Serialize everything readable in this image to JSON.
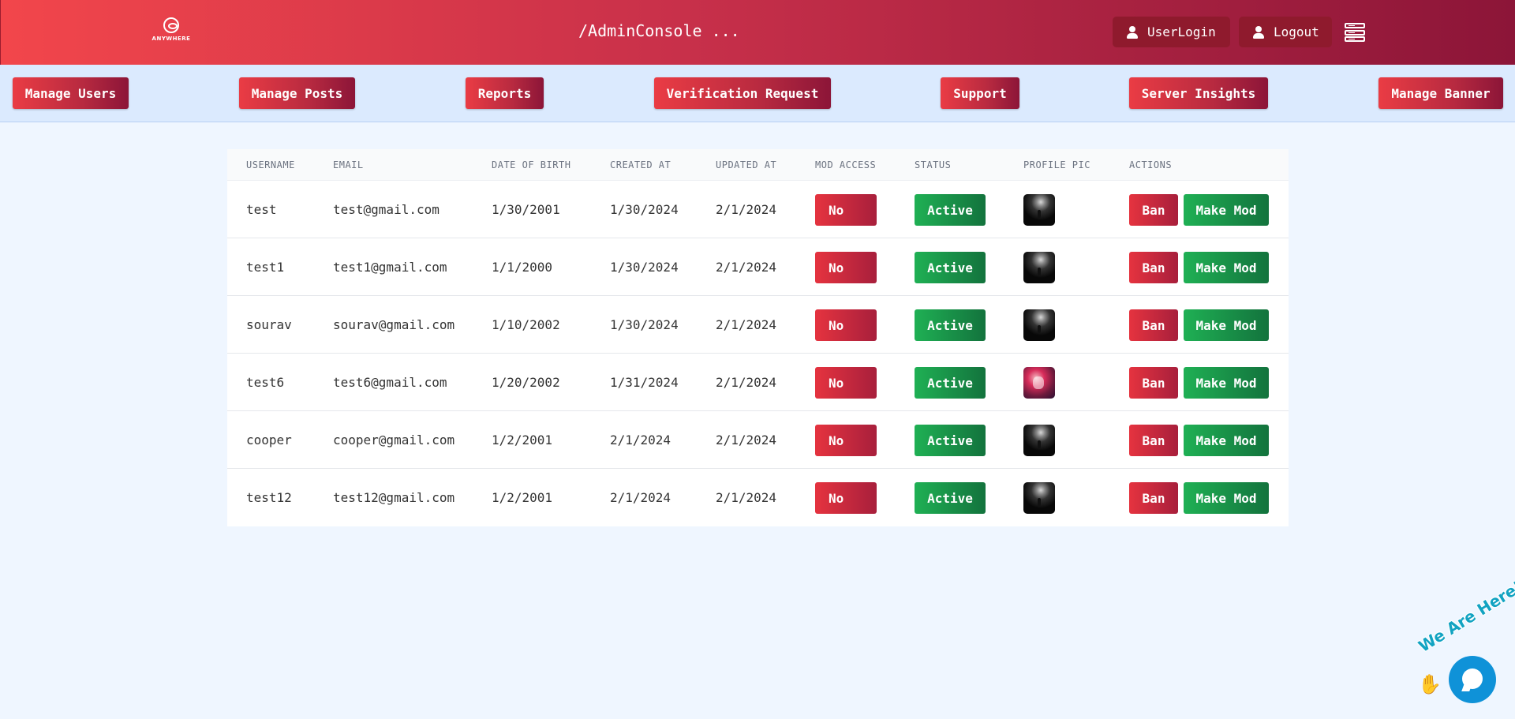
{
  "header": {
    "logo_text": "ANYWHERE",
    "title": "/AdminConsole ...",
    "user_login_label": "UserLogin",
    "logout_label": "Logout",
    "icons": [
      "user-icon",
      "server-icon"
    ]
  },
  "nav": [
    {
      "label": "Manage Users"
    },
    {
      "label": "Manage Posts"
    },
    {
      "label": "Reports"
    },
    {
      "label": "Verification Request"
    },
    {
      "label": "Support"
    },
    {
      "label": "Server Insights"
    },
    {
      "label": "Manage Banner"
    }
  ],
  "table": {
    "columns": [
      "USERNAME",
      "EMAIL",
      "DATE OF BIRTH",
      "CREATED AT",
      "UPDATED AT",
      "MOD ACCESS",
      "STATUS",
      "PROFILE PIC",
      "ACTIONS"
    ],
    "ban_label": "Ban",
    "make_mod_label": "Make Mod",
    "rows": [
      {
        "username": "test",
        "email": "test@gmail.com",
        "dob": "1/30/2001",
        "created": "1/30/2024",
        "updated": "2/1/2024",
        "mod_access": "No",
        "status": "Active",
        "avatar": "dark"
      },
      {
        "username": "test1",
        "email": "test1@gmail.com",
        "dob": "1/1/2000",
        "created": "1/30/2024",
        "updated": "2/1/2024",
        "mod_access": "No",
        "status": "Active",
        "avatar": "dark"
      },
      {
        "username": "sourav",
        "email": "sourav@gmail.com",
        "dob": "1/10/2002",
        "created": "1/30/2024",
        "updated": "2/1/2024",
        "mod_access": "No",
        "status": "Active",
        "avatar": "dark"
      },
      {
        "username": "test6",
        "email": "test6@gmail.com",
        "dob": "1/20/2002",
        "created": "1/31/2024",
        "updated": "2/1/2024",
        "mod_access": "No",
        "status": "Active",
        "avatar": "anime"
      },
      {
        "username": "cooper",
        "email": "cooper@gmail.com",
        "dob": "1/2/2001",
        "created": "2/1/2024",
        "updated": "2/1/2024",
        "mod_access": "No",
        "status": "Active",
        "avatar": "dark"
      },
      {
        "username": "test12",
        "email": "test12@gmail.com",
        "dob": "1/2/2001",
        "created": "2/1/2024",
        "updated": "2/1/2024",
        "mod_access": "No",
        "status": "Active",
        "avatar": "dark"
      }
    ]
  },
  "chat_widget": {
    "tagline": "We Are Here!",
    "icons": [
      "wave-icon",
      "chat-icon"
    ]
  }
}
